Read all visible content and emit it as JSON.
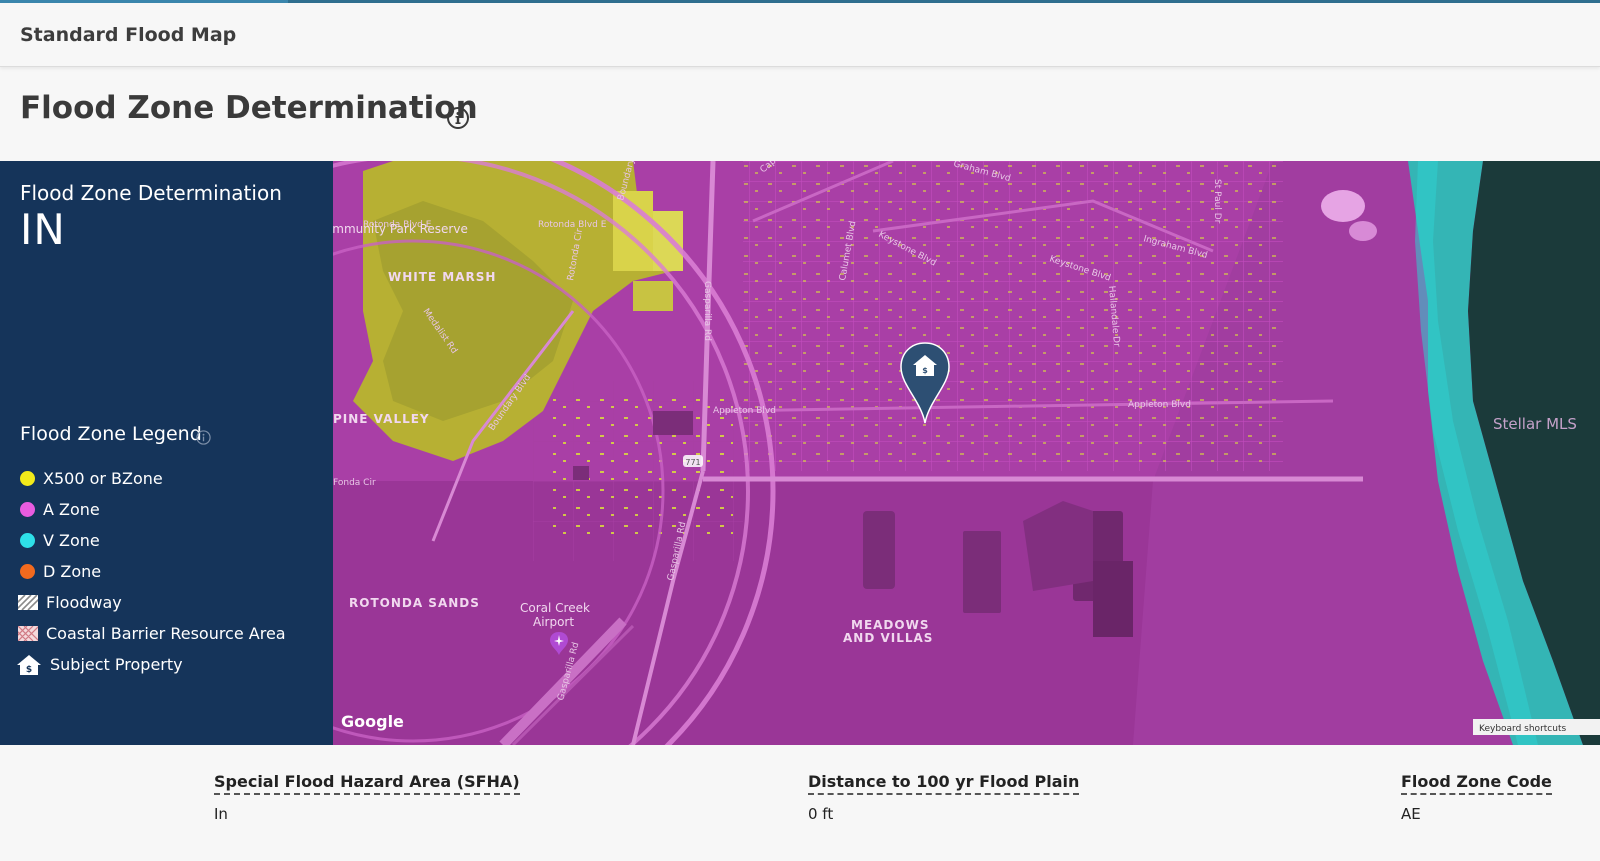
{
  "header": {
    "title": "Standard Flood Map"
  },
  "page": {
    "title": "Flood Zone Determination"
  },
  "panel": {
    "determination_label": "Flood Zone Determination",
    "determination_value": "IN",
    "legend_title": "Flood Zone Legend",
    "legend": [
      {
        "label": "X500 or BZone",
        "color": "#f2ea1a"
      },
      {
        "label": "A Zone",
        "color": "#e85ce0"
      },
      {
        "label": "V Zone",
        "color": "#2ee0e8"
      },
      {
        "label": "D Zone",
        "color": "#f26a1e"
      },
      {
        "label": "Floodway",
        "icon": "hatch-swatch-icon"
      },
      {
        "label": "Coastal Barrier Resource Area",
        "icon": "cross-hatch-swatch-icon"
      },
      {
        "label": "Subject Property",
        "icon": "house-icon"
      }
    ]
  },
  "map": {
    "labels": {
      "white_marsh": "WHITE MARSH",
      "pine_valley": "PINE VALLEY",
      "rotonda_sands": "ROTONDA SANDS",
      "coral_creek_1": "Coral Creek",
      "coral_creek_2": "Airport",
      "meadows_1": "MEADOWS",
      "meadows_2": "AND VILLAS",
      "appleton_w": "Appleton Blvd",
      "appleton_e": "Appleton Blvd",
      "keystone_w": "Keystone Blvd",
      "keystone_e": "Keystone Blvd",
      "ingraham": "Ingraham Blvd",
      "rotonda_blvd_e1": "Rotonda Blvd E",
      "rotonda_blvd_e2": "Rotonda Blvd E",
      "rotonda_cir": "Rotonda Cir",
      "boundary_blvd_n": "Boundary Blvd",
      "boundary_blvd_s": "Boundary Blvd",
      "gasparilla_n": "Gasparilla Rd",
      "gasparilla_s": "Gasparilla Rd",
      "calumet": "Calumet Blvd",
      "hallandale": "Hallandale Dr",
      "st_paul": "St Paul Dr",
      "cape_haze": "Cape Haze Dr",
      "graham": "Graham Blvd",
      "medalist": "Medalist Rd",
      "fonda_cir": "Fonda Cir",
      "rotonda_community": "Rotonda Community Park Reserve",
      "route": "771",
      "watermark": "Stellar MLS",
      "google": "Google",
      "shortcuts": "Keyboard shortcuts"
    }
  },
  "stats": [
    {
      "label": "Special Flood Hazard Area (SFHA)",
      "value": "In"
    },
    {
      "label": "Distance to 100 yr Flood Plain",
      "value": "0 ft"
    },
    {
      "label": "Flood Zone Code",
      "value": "AE"
    }
  ]
}
